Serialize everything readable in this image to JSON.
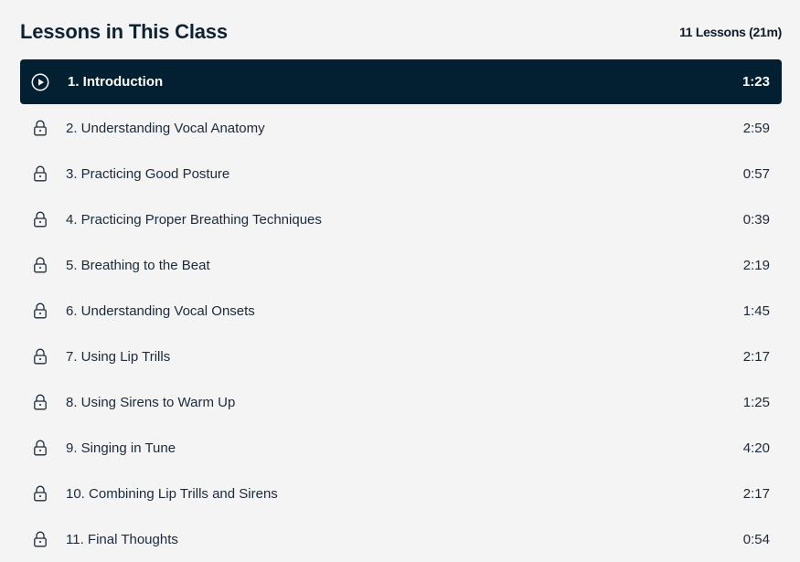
{
  "header": {
    "title": "Lessons in This Class",
    "summary": "11 Lessons (21m)"
  },
  "colors": {
    "active_bg": "#022032",
    "page_bg": "#f4f4f4",
    "text": "#1a2a3a"
  },
  "lessons": [
    {
      "label": "1. Introduction",
      "duration": "1:23",
      "icon": "play-circle-icon",
      "active": true
    },
    {
      "label": "2. Understanding Vocal Anatomy",
      "duration": "2:59",
      "icon": "lock-icon",
      "active": false
    },
    {
      "label": "3. Practicing Good Posture",
      "duration": "0:57",
      "icon": "lock-icon",
      "active": false
    },
    {
      "label": "4. Practicing Proper Breathing Techniques",
      "duration": "0:39",
      "icon": "lock-icon",
      "active": false
    },
    {
      "label": "5. Breathing to the Beat",
      "duration": "2:19",
      "icon": "lock-icon",
      "active": false
    },
    {
      "label": "6. Understanding Vocal Onsets",
      "duration": "1:45",
      "icon": "lock-icon",
      "active": false
    },
    {
      "label": "7. Using Lip Trills",
      "duration": "2:17",
      "icon": "lock-icon",
      "active": false
    },
    {
      "label": "8. Using Sirens to Warm Up",
      "duration": "1:25",
      "icon": "lock-icon",
      "active": false
    },
    {
      "label": "9. Singing in Tune",
      "duration": "4:20",
      "icon": "lock-icon",
      "active": false
    },
    {
      "label": "10. Combining Lip Trills and Sirens",
      "duration": "2:17",
      "icon": "lock-icon",
      "active": false
    },
    {
      "label": "11. Final Thoughts",
      "duration": "0:54",
      "icon": "lock-icon",
      "active": false
    }
  ]
}
